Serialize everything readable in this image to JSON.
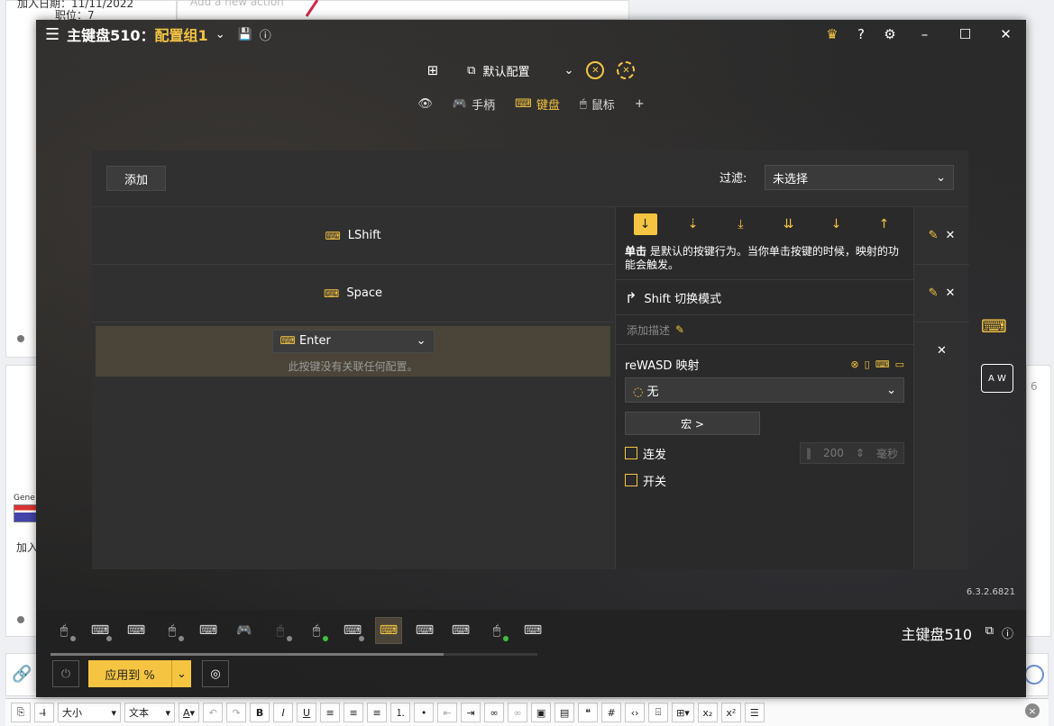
{
  "host": {
    "join_date_label": "加入日期：11/11/2022",
    "position_label": "职位：",
    "position_value": "7",
    "add_action_placeholder": "Add a new action",
    "gene_label": "Gene",
    "join_short": "加入",
    "right_number": "6",
    "toolbar": {
      "fontsize_label": "大小",
      "format_label": "文本",
      "color_label": "A"
    }
  },
  "app": {
    "title": "主键盘510：",
    "config_name": "配置组1",
    "default_config": "默认配置",
    "tabs": [
      {
        "label": "手柄"
      },
      {
        "label": "键盘"
      },
      {
        "label": "鼠标"
      }
    ],
    "add_tab": "+",
    "panel": {
      "add_button": "添加",
      "filter_label": "过滤:",
      "filter_value": "未选择"
    },
    "keys": [
      {
        "label": "LShift"
      },
      {
        "label": "Space"
      },
      {
        "label": "Enter",
        "note": "此按键没有关联任何配置。"
      }
    ],
    "action": {
      "desc_bold": "单击",
      "desc_rest": " 是默认的按键行为。当你单击按键的时候，映射的功能会触发。",
      "shift_mode": "Shift 切换模式",
      "add_description": "添加描述",
      "mapping_title": "reWASD 映射",
      "mapping_value": "无",
      "macro_button": "宏 >",
      "turbo_label": "连发",
      "turbo_value": "200",
      "turbo_unit": "毫秒",
      "toggle_label": "开关"
    },
    "version": "6.3.2.6821",
    "device_name": "主键盘510",
    "apply_button": "应用到 %",
    "colors": {
      "accent": "#f5c542",
      "background": "#262626"
    }
  }
}
